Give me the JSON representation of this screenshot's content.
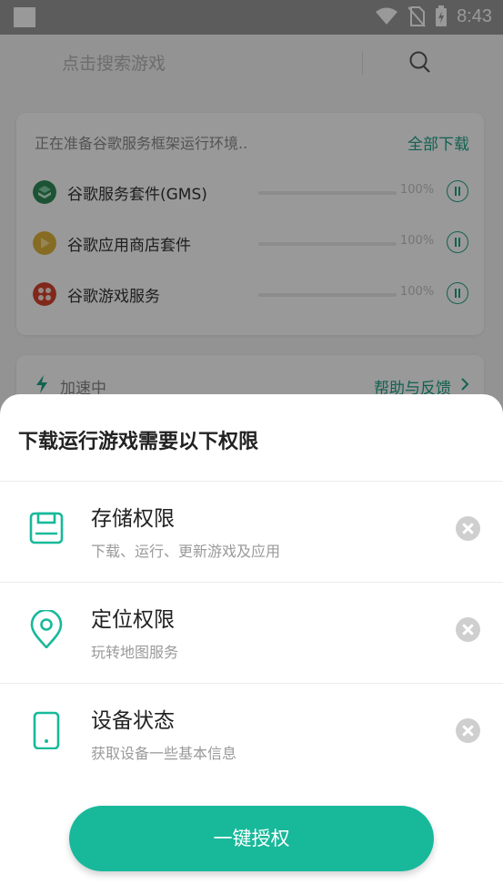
{
  "status_bar": {
    "time": "8:43"
  },
  "search": {
    "placeholder": "点击搜索游戏"
  },
  "prep_card": {
    "status_text": "正在准备谷歌服务框架运行环境..",
    "download_all": "全部下载",
    "services": [
      {
        "name": "谷歌服务套件(GMS)",
        "progress": "100%",
        "icon": "gms-icon"
      },
      {
        "name": "谷歌应用商店套件",
        "progress": "100%",
        "icon": "play-store-icon"
      },
      {
        "name": "谷歌游戏服务",
        "progress": "100%",
        "icon": "play-games-icon"
      }
    ]
  },
  "accel_card": {
    "status": "加速中",
    "help": "帮助与反馈"
  },
  "sheet": {
    "title": "下载运行游戏需要以下权限",
    "permissions": [
      {
        "title": "存储权限",
        "desc": "下载、运行、更新游戏及应用",
        "icon": "storage-icon"
      },
      {
        "title": "定位权限",
        "desc": "玩转地图服务",
        "icon": "location-pin-icon"
      },
      {
        "title": "设备状态",
        "desc": "获取设备一些基本信息",
        "icon": "phone-icon"
      }
    ],
    "grant_button": "一键授权"
  },
  "colors": {
    "accent": "#17b99a",
    "link": "#1fa386"
  }
}
